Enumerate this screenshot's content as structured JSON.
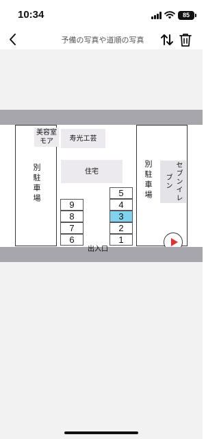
{
  "status_bar": {
    "time": "10:34",
    "battery": "85"
  },
  "nav": {
    "title": "予備の写真や道順の写真",
    "back_icon": "chevron-left-icon",
    "sort_icon": "sort-arrows-icon",
    "trash_icon": "trash-icon"
  },
  "map": {
    "lot_left_label": "別駐車場",
    "lot_right_label": "別駐車場",
    "beauty_shop": "美容室モア",
    "kotobuki": "寿光工芸",
    "housing": "住宅",
    "seven_eleven": "セブンイレブン",
    "entrance": "出入口",
    "compass_icon": "compass-arrow-icon",
    "spots_right": [
      "5",
      "4",
      "3",
      "2",
      "1"
    ],
    "spots_left": [
      "9",
      "8",
      "7",
      "6"
    ],
    "highlighted_spot": "3",
    "highlight_color": "#7fd3ef"
  }
}
